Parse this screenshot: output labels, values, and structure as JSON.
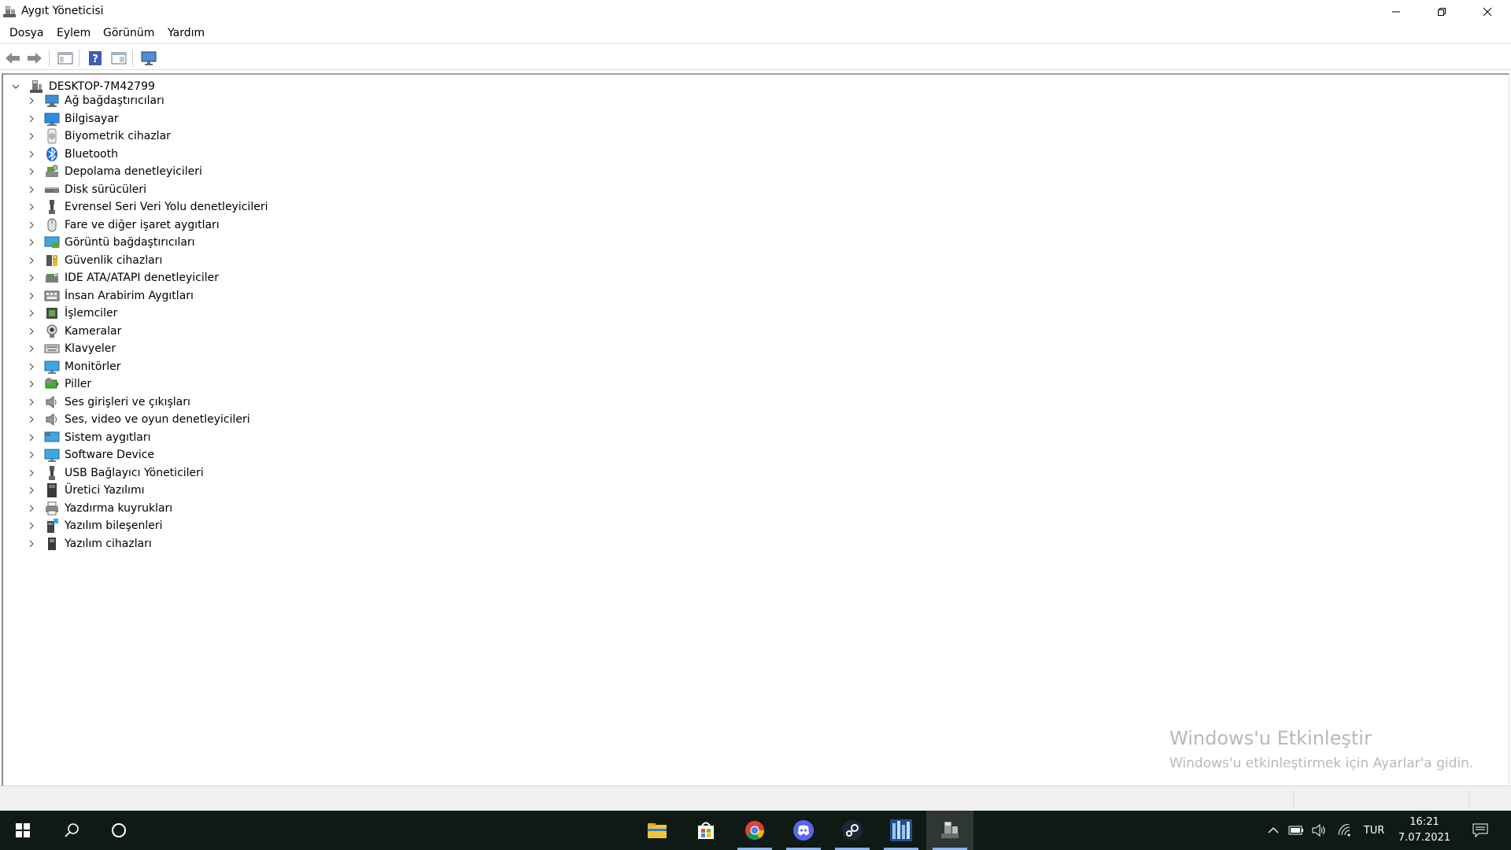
{
  "window": {
    "title": "Aygıt Yöneticisi"
  },
  "menu": {
    "items": [
      "Dosya",
      "Eylem",
      "Görünüm",
      "Yardım"
    ]
  },
  "tree": {
    "root": "DESKTOP-7M42799",
    "items": [
      {
        "label": "Ağ bağdaştırıcıları",
        "icon": "network-adapter-icon"
      },
      {
        "label": "Bilgisayar",
        "icon": "computer-icon"
      },
      {
        "label": "Biyometrik cihazlar",
        "icon": "biometric-icon"
      },
      {
        "label": "Bluetooth",
        "icon": "bluetooth-icon"
      },
      {
        "label": "Depolama denetleyicileri",
        "icon": "storage-controller-icon"
      },
      {
        "label": "Disk sürücüleri",
        "icon": "disk-drive-icon"
      },
      {
        "label": "Evrensel Seri Veri Yolu denetleyicileri",
        "icon": "usb-controller-icon"
      },
      {
        "label": "Fare ve diğer işaret aygıtları",
        "icon": "mouse-icon"
      },
      {
        "label": "Görüntü bağdaştırıcıları",
        "icon": "display-adapter-icon"
      },
      {
        "label": "Güvenlik cihazları",
        "icon": "security-device-icon"
      },
      {
        "label": "IDE ATA/ATAPI denetleyiciler",
        "icon": "ide-controller-icon"
      },
      {
        "label": "İnsan Arabirim Aygıtları",
        "icon": "hid-icon"
      },
      {
        "label": "İşlemciler",
        "icon": "processor-icon"
      },
      {
        "label": "Kameralar",
        "icon": "camera-icon"
      },
      {
        "label": "Klavyeler",
        "icon": "keyboard-icon"
      },
      {
        "label": "Monitörler",
        "icon": "monitor-icon"
      },
      {
        "label": "Piller",
        "icon": "battery-icon"
      },
      {
        "label": "Ses girişleri ve çıkışları",
        "icon": "audio-io-icon"
      },
      {
        "label": "Ses, video ve oyun denetleyicileri",
        "icon": "sound-video-icon"
      },
      {
        "label": "Sistem aygıtları",
        "icon": "system-device-icon"
      },
      {
        "label": "Software Device",
        "icon": "software-device-icon"
      },
      {
        "label": "USB Bağlayıcı Yöneticileri",
        "icon": "usb-connector-icon"
      },
      {
        "label": "Üretici Yazılımı",
        "icon": "firmware-icon"
      },
      {
        "label": "Yazdırma kuyrukları",
        "icon": "print-queue-icon"
      },
      {
        "label": "Yazılım bileşenleri",
        "icon": "software-component-icon"
      },
      {
        "label": "Yazılım cihazları",
        "icon": "software-device-2-icon"
      }
    ]
  },
  "watermark": {
    "title": "Windows'u Etkinleştir",
    "subtitle": "Windows'u etkinleştirmek için Ayarlar'a gidin."
  },
  "taskbar": {
    "language": "TUR",
    "time": "16:21",
    "date": "7.07.2021",
    "apps": [
      "file-explorer-icon",
      "store-icon",
      "chrome-icon",
      "discord-icon",
      "steam-icon",
      "pes-icon",
      "device-manager-icon"
    ]
  },
  "colors": {
    "taskbar_bg": "#101a14",
    "accent": "#8ab4f0",
    "watermark": "#b8b8b8"
  }
}
